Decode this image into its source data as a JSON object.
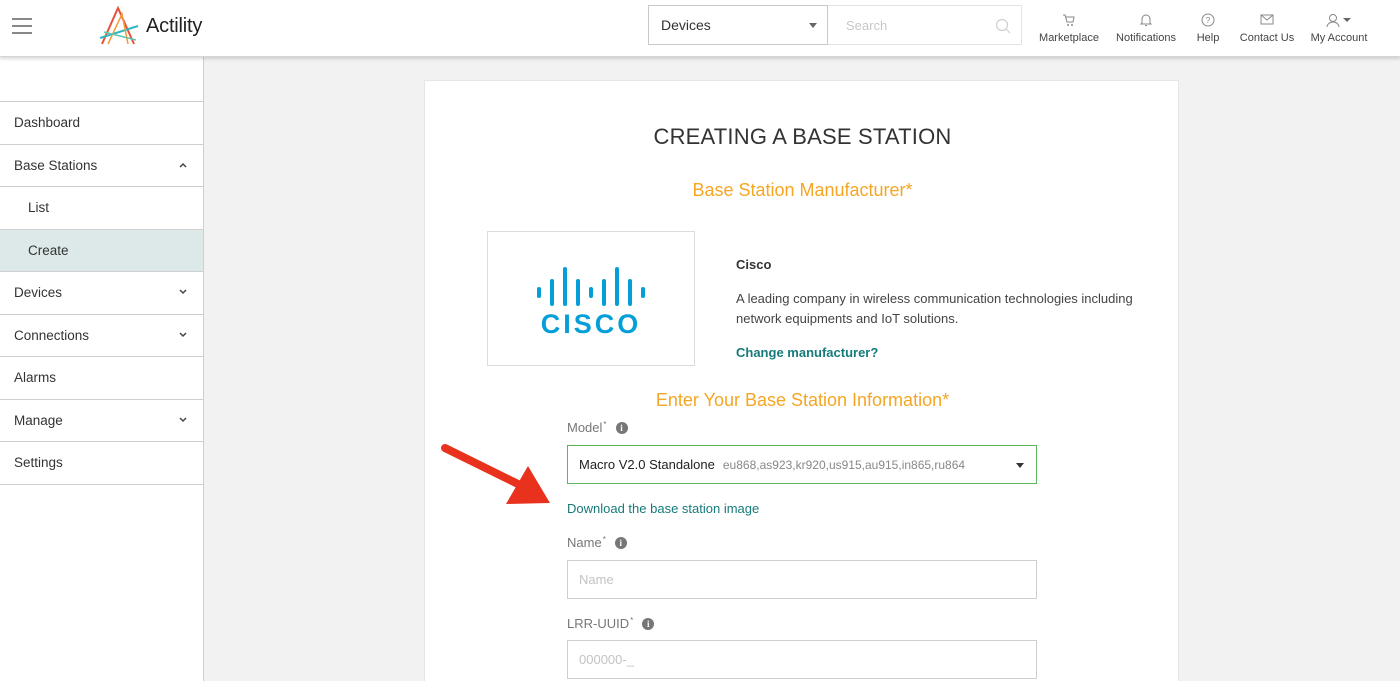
{
  "header": {
    "brand": "Actility",
    "selector_value": "Devices",
    "search_placeholder": "Search",
    "nav": [
      {
        "label": "Marketplace",
        "icon": "cart-icon"
      },
      {
        "label": "Notifications",
        "icon": "bell-icon"
      },
      {
        "label": "Help",
        "icon": "question-icon"
      },
      {
        "label": "Contact Us",
        "icon": "envelope-icon"
      },
      {
        "label": "My Account",
        "icon": "user-icon"
      }
    ]
  },
  "sidebar": {
    "items": [
      {
        "label": "Dashboard"
      },
      {
        "label": "Base Stations",
        "chevron": "up"
      },
      {
        "label": "List",
        "sub": true
      },
      {
        "label": "Create",
        "sub": true,
        "active": true
      },
      {
        "label": "Devices",
        "chevron": "down"
      },
      {
        "label": "Connections",
        "chevron": "down"
      },
      {
        "label": "Alarms"
      },
      {
        "label": "Manage",
        "chevron": "down"
      },
      {
        "label": "Settings"
      }
    ]
  },
  "main": {
    "title": "CREATING A BASE STATION",
    "manufacturer_section": "Base Station Manufacturer*",
    "manufacturer": {
      "logo_text": "CISCO",
      "name": "Cisco",
      "description": "A leading company in wireless communication technologies including network equipments and IoT solutions.",
      "change_link": "Change manufacturer?"
    },
    "info_section": "Enter Your Base Station Information*",
    "model_label": "Model",
    "model_value": "Macro V2.0 Standalone",
    "model_frequencies": "eu868,as923,kr920,us915,au915,in865,ru864",
    "download_link": "Download the base station image",
    "name_label": "Name",
    "name_placeholder": "Name",
    "lrr_label": "LRR-UUID",
    "lrr_placeholder": "000000-_",
    "required_mark": "*",
    "info_glyph": "i"
  },
  "colors": {
    "accent_orange": "#f5a623",
    "link_teal": "#167a7a",
    "cisco_blue": "#049fd9",
    "arrow_red": "#e8321e",
    "select_border_green": "#5ab85c",
    "active_bg": "#dde9e9"
  }
}
